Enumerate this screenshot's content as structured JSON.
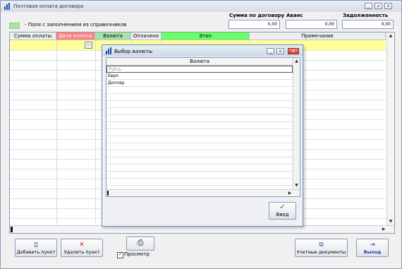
{
  "window": {
    "title": "Почтовая оплата договора",
    "buttons": [
      "minimize",
      "restore",
      "close"
    ]
  },
  "legend": {
    "color": "#a6e4a6",
    "text": "- Поля с заполнением из справочников"
  },
  "fields": {
    "contract_sum": {
      "label": "Сумма по договору",
      "value": "0,00"
    },
    "advance": {
      "label": "Аванс",
      "value": "0,00"
    },
    "debt": {
      "label": "Задолженность",
      "value": "0,00"
    }
  },
  "grid": {
    "columns": [
      {
        "label": "Сумма оплаты",
        "color": "#eeeeee"
      },
      {
        "label": "Дата оплаты",
        "color": "#ff7f7f"
      },
      {
        "label": "Валюта",
        "color": "#a6e4a6"
      },
      {
        "label": "Оплачено",
        "color": "#eeeeee"
      },
      {
        "label": "Этап",
        "color": "#66ff66"
      },
      {
        "label": "Примечание",
        "color": "#eeeeee"
      }
    ],
    "row_highlight_color": "#ffff99",
    "ellipsis": "..."
  },
  "buttons": {
    "add": {
      "label": "Добавить пункт",
      "icon": "document-icon"
    },
    "delete": {
      "label": "Удалить пункт",
      "icon": "red-x-icon"
    },
    "print": {
      "icon": "printer-icon"
    },
    "preview": {
      "label": "Просмотр",
      "checked": true
    },
    "accounting_docs": {
      "label": "Учетные документы",
      "icon": "documents-icon"
    },
    "exit": {
      "label": "Выход",
      "icon": "exit-door-icon"
    }
  },
  "dialog": {
    "title": "Выбор валюты",
    "column": "Валюта",
    "items": [
      "Рубль",
      "Евро",
      "Доллар"
    ],
    "selected_index": 0,
    "ok_label": "Ввод"
  }
}
